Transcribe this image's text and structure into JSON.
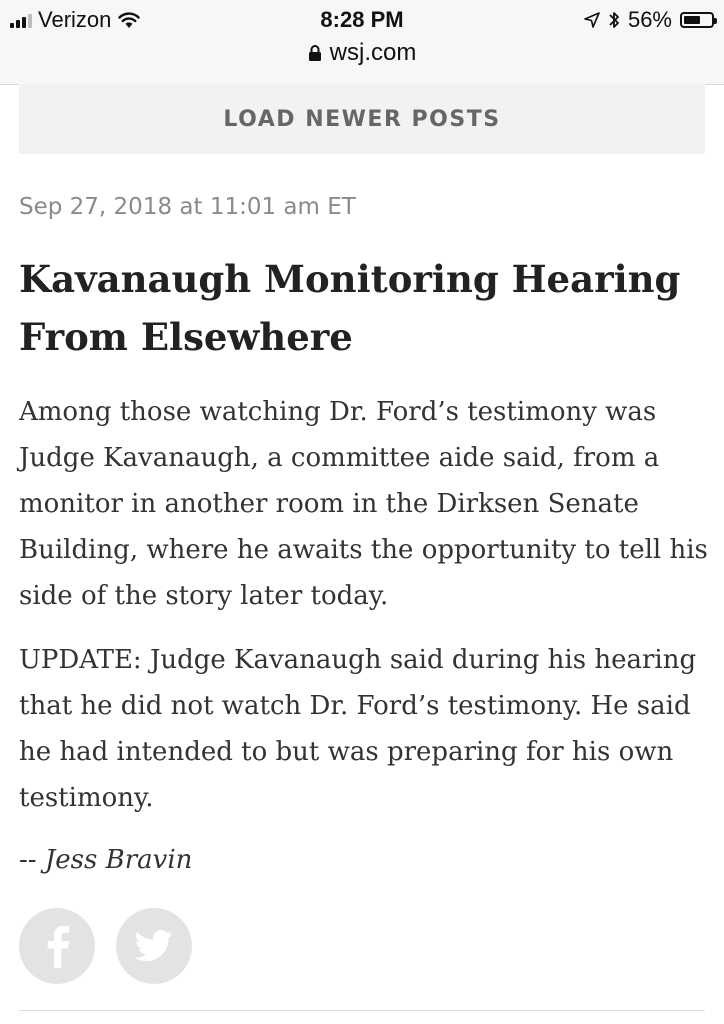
{
  "status_bar": {
    "carrier": "Verizon",
    "time": "8:28 PM",
    "battery": "56%",
    "battery_level": 0.56,
    "url": "wsj.com"
  },
  "feed": {
    "load_newer_label": "LOAD NEWER POSTS"
  },
  "post": {
    "timestamp": "Sep 27, 2018 at 11:01 am ET",
    "headline": "Kavanaugh Monitoring Hearing From Elsewhere",
    "paragraphs": [
      "Among those watching Dr. Ford’s testimony was Judge Kavanaugh, a committee aide said, from a monitor in another room in the Dirksen Senate Building, where he awaits the opportunity to tell his side of the story later today.",
      "UPDATE: Judge Kavanaugh said during his hearing that he did not watch Dr. Ford’s testimony. He said he had intended to but was preparing for his own testimony."
    ],
    "byline": "-- Jess Bravin"
  },
  "share": {
    "icons": [
      "facebook-icon",
      "twitter-icon"
    ],
    "icon_color": "#ffffff",
    "button_color": "#e3e3e3"
  }
}
